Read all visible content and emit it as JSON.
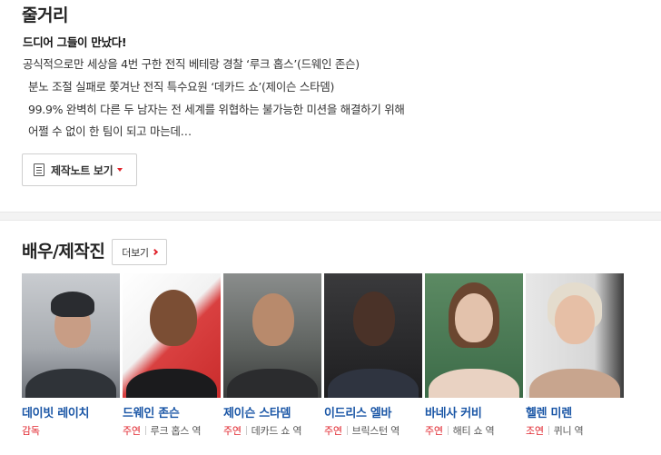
{
  "synopsis": {
    "title": "줄거리",
    "tagline": "드디어 그들이 만났다!",
    "lines": [
      "공식적으로만 세상을 4번 구한 전직 베테랑 경찰 ‘루크 홉스’(드웨인 존슨)",
      "분노 조절 실패로 쫓겨난 전직 특수요원 ‘데카드 쇼’(제이슨 스타뎀)",
      "99.9% 완벽히 다른 두 남자는 전 세계를 위협하는 불가능한 미션을 해결하기 위해",
      "어쩔 수 없이 한 팀이 되고 마는데…"
    ],
    "note_button_label": "제작노트 보기"
  },
  "cast": {
    "title": "배우/제작진",
    "more_label": "더보기",
    "members": [
      {
        "name": "데이빗 레이치",
        "role_type": "감독",
        "role": ""
      },
      {
        "name": "드웨인 존슨",
        "role_type": "주연",
        "role": "루크 홉스 역"
      },
      {
        "name": "제이슨 스타뎀",
        "role_type": "주연",
        "role": "데카드 쇼 역"
      },
      {
        "name": "이드리스 엘바",
        "role_type": "주연",
        "role": "브릭스턴 역"
      },
      {
        "name": "바네사 커비",
        "role_type": "주연",
        "role": "해티 쇼 역"
      },
      {
        "name": "헬렌 미렌",
        "role_type": "조연",
        "role": "퀴니 역"
      }
    ]
  },
  "colors": {
    "accent": "#e0242c",
    "link": "#1a56a6"
  }
}
